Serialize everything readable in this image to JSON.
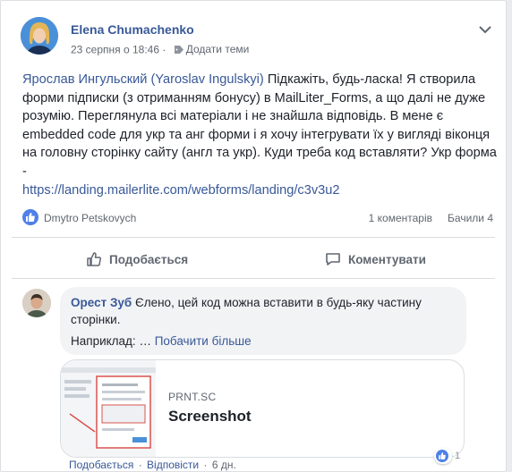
{
  "post": {
    "author": "Elena Chumachenko",
    "date": "23 серпня о 18:46",
    "tag_link": "Додати теми",
    "mention": "Ярослав Ингульский (Yaroslav Ingulskyi)",
    "body": " Підкажіть, будь-ласка! Я створила форми підписки (з отриманням бонусу) в MailLiter_Forms, а що далі не дуже розумію. Переглянула всі матеріали і не знайшла відповідь. В мене є embedded code для укр та анг форми і я хочу інтегрувати їх у вигляді віконця на головну сторінку сайту (англ та укр). Куди треба код вставляти? Укр форма -",
    "link": "https://landing.mailerlite.com/webforms/landing/c3v3u2"
  },
  "stats": {
    "reaction_name": "Dmytro Petskovych",
    "comments": "1 коментарів",
    "views": "Бачили 4"
  },
  "actions": {
    "like": "Подобається",
    "comment": "Коментувати"
  },
  "comment": {
    "author": "Орест Зуб",
    "text": " Єлено, цей код можна вставити в будь-яку частину сторінки.",
    "more_prefix": "Наприклад: … ",
    "more_link": "Побачити більше",
    "preview": {
      "domain": "PRNT.SC",
      "title": "Screenshot"
    },
    "like": "Подобається",
    "reply": "Відповісти",
    "time": "6 дн.",
    "like_count": "1"
  },
  "colors": {
    "link": "#385898",
    "like_blue": "#4f7fe8"
  }
}
